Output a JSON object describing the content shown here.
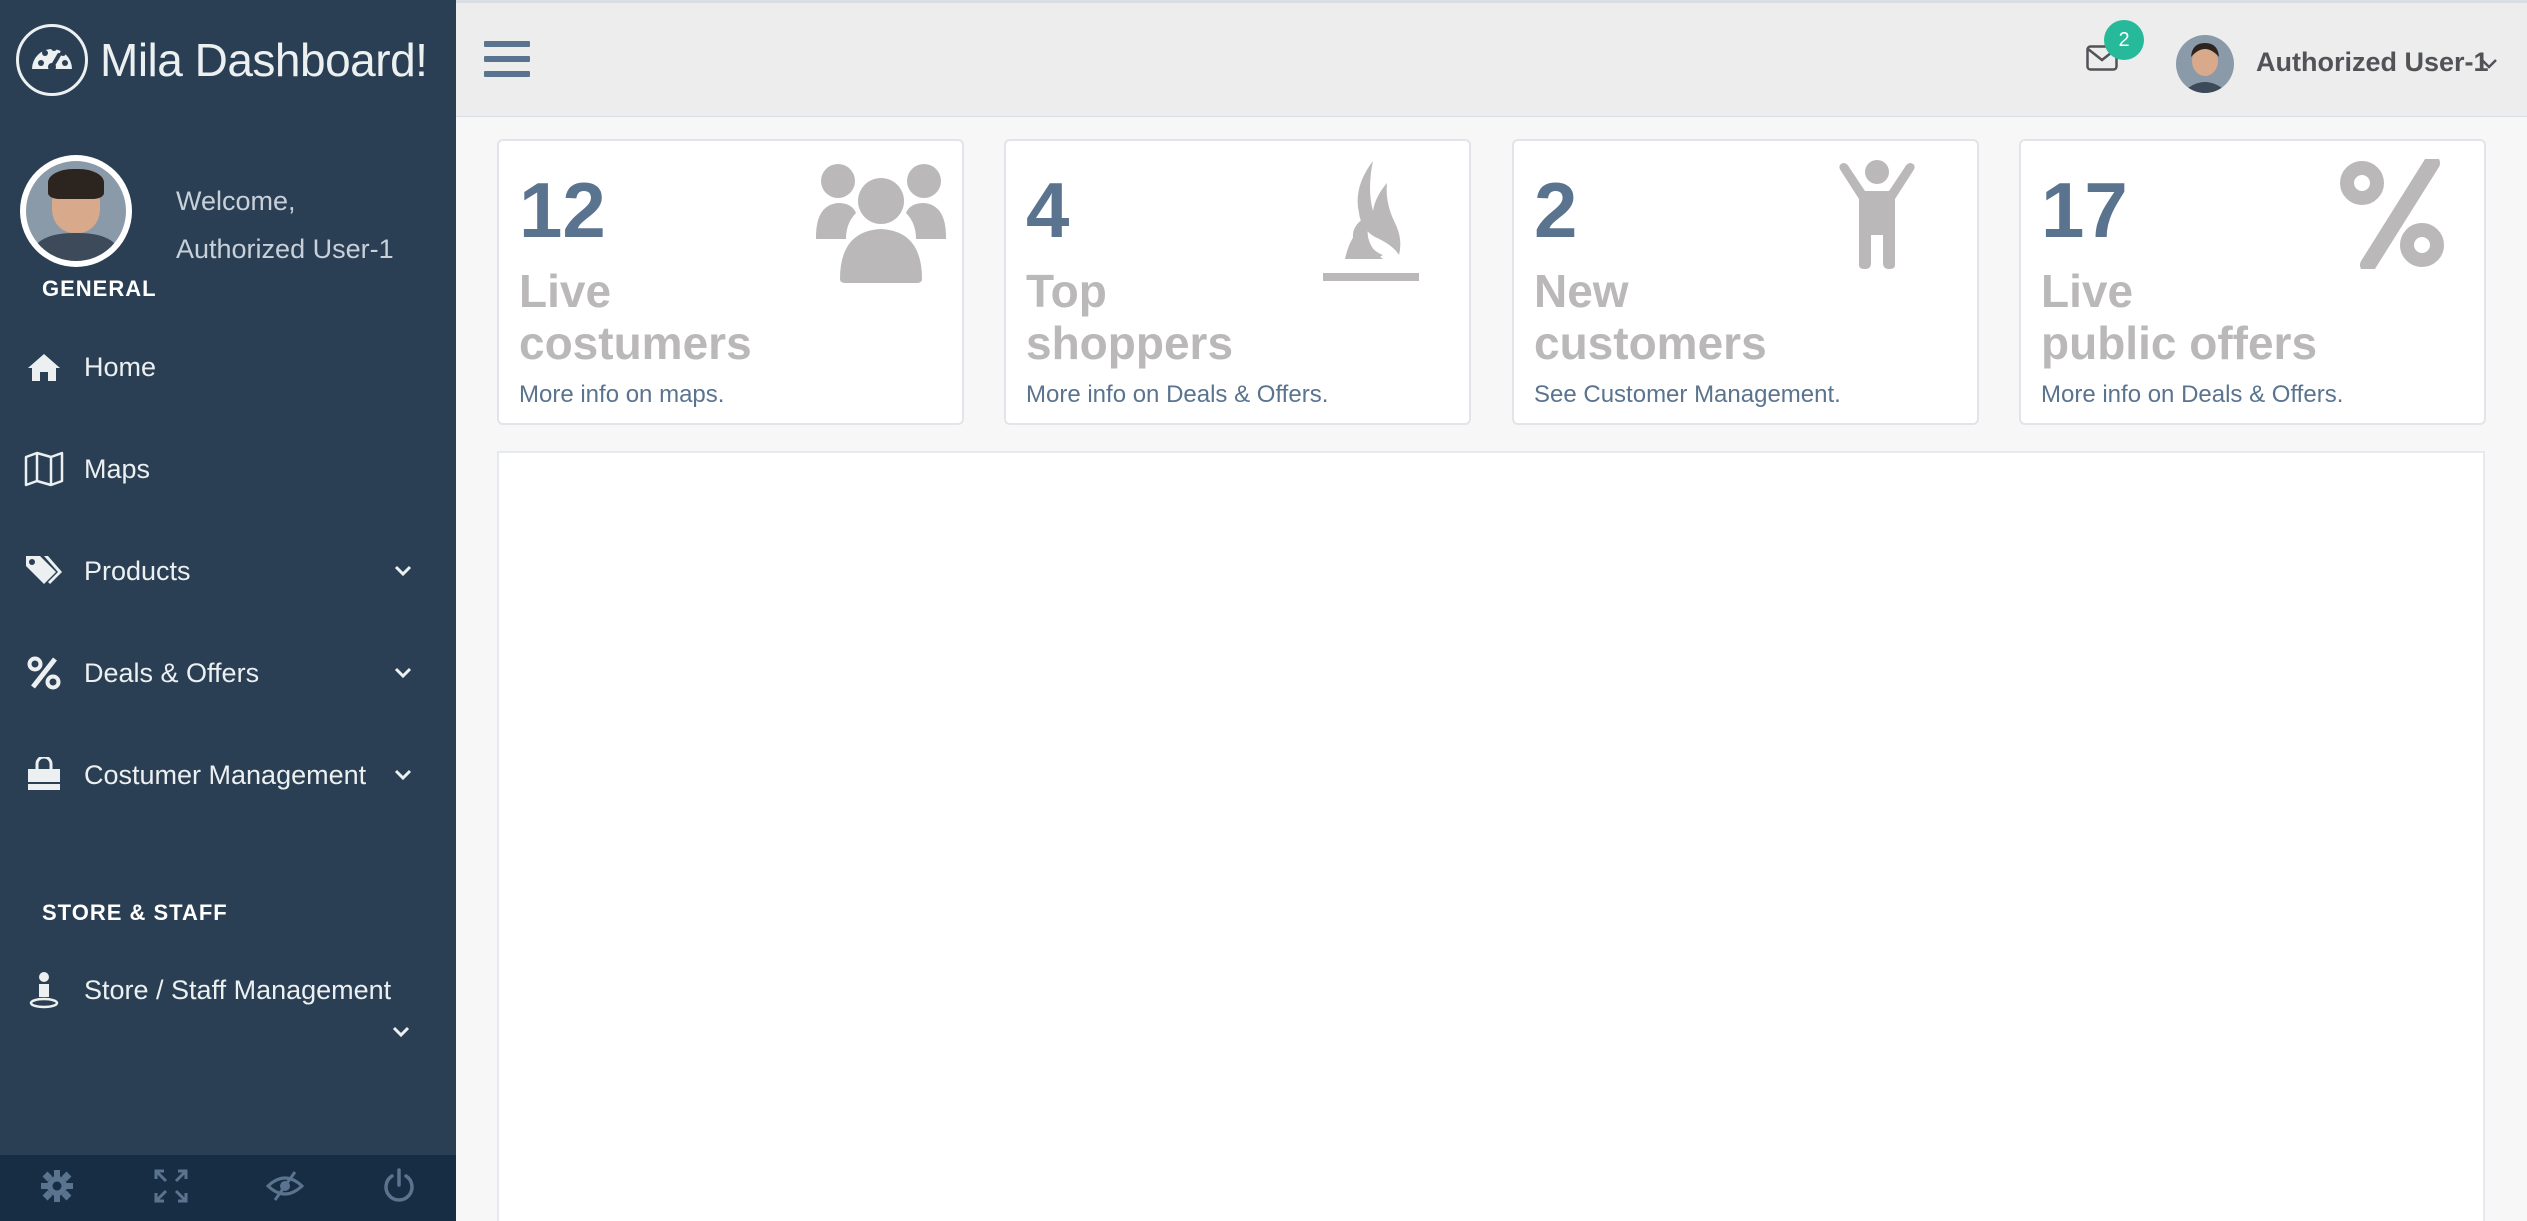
{
  "brand": {
    "title": "Mila Dashboard!"
  },
  "profile": {
    "welcome": "Welcome,",
    "name": "Authorized User-1"
  },
  "sidebar": {
    "section_general": "GENERAL",
    "items": [
      {
        "label": "Home",
        "icon": "home-icon"
      },
      {
        "label": "Maps",
        "icon": "map-icon"
      },
      {
        "label": "Products",
        "icon": "tags-icon"
      },
      {
        "label": "Deals & Offers",
        "icon": "percent-icon"
      },
      {
        "label": "Costumer Management",
        "icon": "shopping-bag-icon"
      }
    ],
    "section_store": "STORE & STAFF",
    "store_item": {
      "label": "Store / Staff Management",
      "icon": "person-pin-icon"
    },
    "footer_icons": [
      "gear-icon",
      "fullscreen-icon",
      "eye-slash-icon",
      "power-icon"
    ]
  },
  "topnav": {
    "mail_count": "2",
    "user_name": "Authorized User-1"
  },
  "tiles": [
    {
      "count": "12",
      "title_line1": "Live",
      "title_line2": "costumers",
      "info": "More info on maps.",
      "icon": "users-icon"
    },
    {
      "count": "4",
      "title_line1": "Top",
      "title_line2": "shoppers",
      "info": "More info on Deals & Offers.",
      "icon": "fire-icon"
    },
    {
      "count": "2",
      "title_line1": "New",
      "title_line2": "customers",
      "info": "See Customer Management.",
      "icon": "child-icon"
    },
    {
      "count": "17",
      "title_line1": "Live",
      "title_line2": "public offers",
      "info": "More info on Deals & Offers.",
      "icon": "percent-icon"
    }
  ],
  "colors": {
    "sidebar": "#2a3f54",
    "accent": "#5a738e",
    "badge": "#26b99a"
  }
}
